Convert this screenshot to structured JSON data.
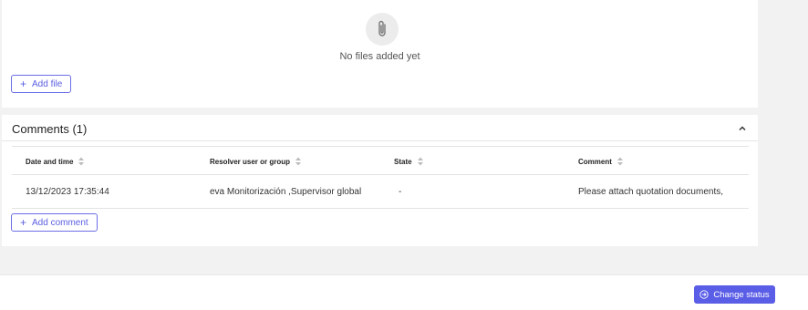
{
  "attachments": {
    "empty_message": "No files added yet",
    "add_file_label": "Add file"
  },
  "comments": {
    "title": "Comments (1)",
    "columns": [
      "Date and time",
      "Resolver user or group",
      "State",
      "Comment"
    ],
    "rows": [
      [
        "13/12/2023 17:35:44",
        "eva Monitorización ,Supervisor global",
        "-",
        "Please attach quotation documents,"
      ]
    ],
    "add_comment_label": "Add comment"
  },
  "footer": {
    "change_status_label": "Change status"
  },
  "colors": {
    "accent": "#5a5de6",
    "background": "#f2f2f2",
    "card": "#ffffff"
  },
  "icons": {
    "attachment": "paperclip-icon",
    "add": "plus-icon",
    "collapse": "chevron-up-icon",
    "sort": "sort-icon",
    "change_status": "arrow-circle-right-icon"
  }
}
